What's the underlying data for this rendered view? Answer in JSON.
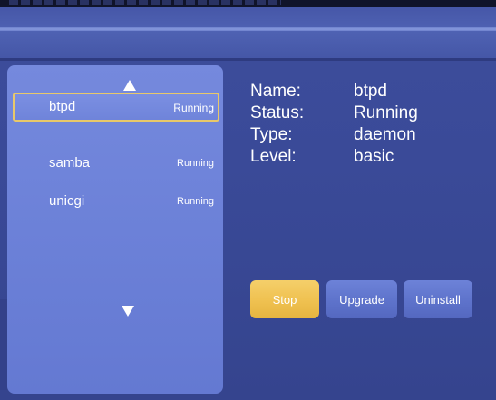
{
  "services": [
    {
      "name": "btpd",
      "status": "Running",
      "selected": true
    },
    {
      "name": "samba",
      "status": "Running",
      "selected": false
    },
    {
      "name": "unicgi",
      "status": "Running",
      "selected": false
    }
  ],
  "details": {
    "name_label": "Name:",
    "name_value": "btpd",
    "status_label": "Status:",
    "status_value": "Running",
    "type_label": "Type:",
    "type_value": "daemon",
    "level_label": "Level:",
    "level_value": "basic"
  },
  "buttons": {
    "stop": "Stop",
    "upgrade": "Upgrade",
    "uninstall": "Uninstall"
  },
  "colors": {
    "background": "#3c4c9a",
    "panel": "#7086da",
    "selected_border": "#e8c86a",
    "focused_button": "#f0c252"
  },
  "icons": {
    "scroll_up": "triangle-up-icon",
    "scroll_down": "triangle-down-icon"
  }
}
